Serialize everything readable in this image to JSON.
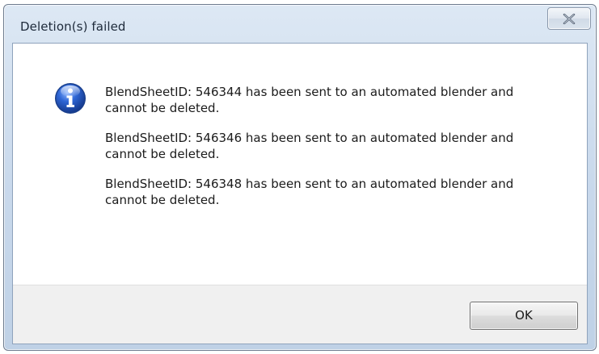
{
  "window": {
    "title": "Deletion(s) failed",
    "close_icon": "close-icon"
  },
  "dialog": {
    "icon": "info-icon",
    "messages": [
      "BlendSheetID: 546344 has been sent to an automated blender and cannot be deleted.",
      "BlendSheetID: 546346 has been sent to an automated blender and cannot be deleted.",
      "BlendSheetID: 546348 has been sent to an automated blender and cannot be deleted."
    ]
  },
  "buttons": {
    "ok_label": "OK"
  },
  "colors": {
    "titlebar": "#c9d9ec",
    "footer": "#f0f0f0",
    "info_icon": "#2a5db8"
  }
}
